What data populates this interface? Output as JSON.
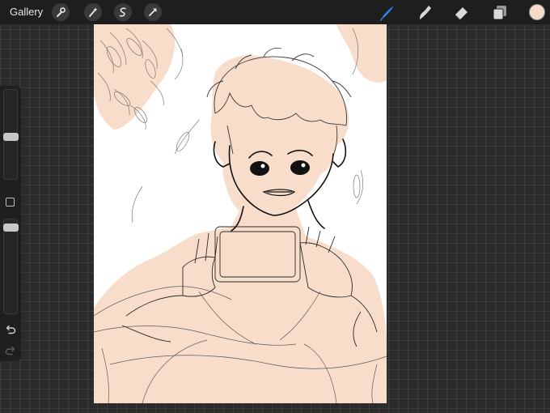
{
  "toolbar": {
    "gallery_label": "Gallery",
    "left_tools": [
      "wrench-icon",
      "magic-wand-icon",
      "selection-icon",
      "transform-arrow-icon"
    ],
    "right_tools": [
      "brush-icon",
      "smudge-icon",
      "eraser-icon",
      "layers-icon"
    ],
    "active_tool": "brush-icon",
    "accent_color": "#2f80ed",
    "current_color": "#f6dcc8"
  },
  "sidebar": {
    "brush_size_level": 0.47,
    "opacity_level": 0.06
  },
  "canvas": {
    "background": "#ffffff",
    "fill_color": "#f8ddcb",
    "line_color": "#1a1a1a"
  }
}
